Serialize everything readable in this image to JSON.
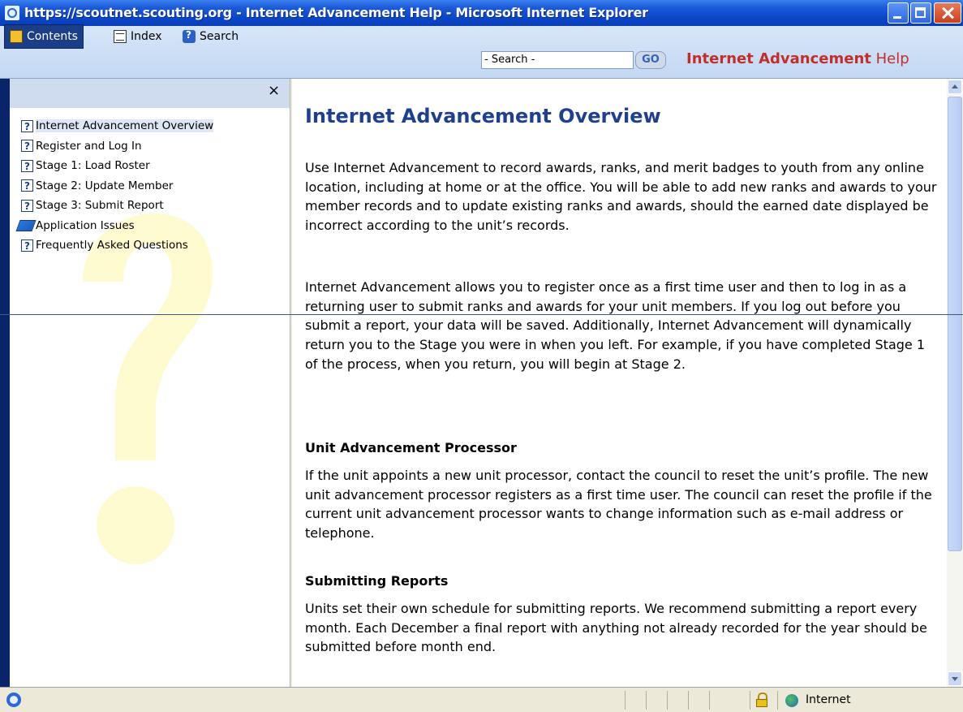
{
  "window": {
    "title": "https://scoutnet.scouting.org - Internet Advancement Help - Microsoft Internet Explorer"
  },
  "toolbar": {
    "tabs": [
      {
        "label": "Contents",
        "icon": "book-icon",
        "active": true
      },
      {
        "label": "Index",
        "icon": "index-icon",
        "active": false
      },
      {
        "label": "Search",
        "icon": "search-icon",
        "active": false
      }
    ],
    "search_value": "- Search -",
    "go_label": "GO",
    "brand_bold": "Internet Advancement",
    "brand_light": "Help",
    "brand_color": "#c0302a"
  },
  "sidebar": {
    "close_label": "×",
    "items": [
      {
        "label": "Internet Advancement Overview",
        "icon": "question-icon",
        "selected": true
      },
      {
        "label": "Register and Log In",
        "icon": "question-icon"
      },
      {
        "label": "Stage 1: Load Roster",
        "icon": "question-icon"
      },
      {
        "label": "Stage 2: Update Member",
        "icon": "question-icon"
      },
      {
        "label": "Stage 3: Submit Report",
        "icon": "question-icon"
      },
      {
        "label": "Application Issues",
        "icon": "book-icon"
      },
      {
        "label": "Frequently Asked Questions",
        "icon": "question-icon"
      }
    ]
  },
  "main": {
    "title": "Internet Advancement Overview",
    "title_color": "#1f3f8f",
    "p1": "Use Internet Advancement to record awards, ranks, and merit badges to youth from any online location, including at home or at the office. You will be able to add new ranks and awards to your member records and to update existing ranks and awards, should the earned date displayed be incorrect according to the unit’s records.",
    "p2": "Internet Advancement allows you to register once as a first time user and then to log in as a returning user to submit ranks and awards for your unit members. If you log out before you submit a report, your data will be saved. Additionally, Internet Advancement will dynamically return you to the Stage you were in when you left. For example, if you have completed Stage 1 of the process, when you return, you will begin at Stage 2.",
    "h_processor": "Unit Advancement Processor",
    "p3": "If the unit appoints a new unit processor, contact the council to reset the unit’s profile. The new unit advancement processor registers as a first time user. The council can reset the profile if the current unit advancement processor wants to change information such as e-mail address or telephone.",
    "h_reports": "Submitting Reports",
    "p4": "Units set their own schedule for submitting reports. We recommend submitting a report every month. Each December a final report with anything not already recorded for the year should be submitted before month end."
  },
  "statusbar": {
    "zone": "Internet"
  }
}
